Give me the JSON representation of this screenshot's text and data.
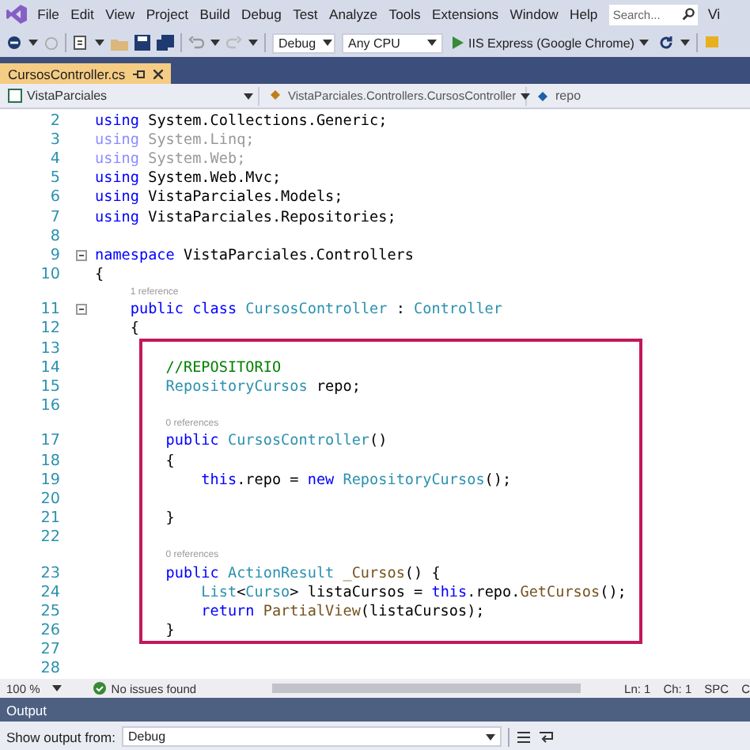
{
  "menu": {
    "items": [
      "File",
      "Edit",
      "View",
      "Project",
      "Build",
      "Debug",
      "Test",
      "Analyze",
      "Tools",
      "Extensions",
      "Window",
      "Help"
    ],
    "search": {
      "placeholder": "Search..."
    },
    "cut_label": "Vi"
  },
  "toolbar": {
    "configuration": "Debug",
    "platform": "Any CPU",
    "run_target": "IIS Express (Google Chrome)"
  },
  "tabs": [
    {
      "label": "CursosController.cs",
      "selected": true
    }
  ],
  "navigation": {
    "project": "VistaParciales",
    "type": "VistaParciales.Controllers.CursosController",
    "member": "repo"
  },
  "editor": {
    "sections": [
      {
        "highlighted": false,
        "rows": [
          {
            "kind": "line",
            "number": "2",
            "fold": false,
            "tokens": [
              {
                "text": "using",
                "kind": "keyword"
              },
              {
                "text": " System.Collections.Generic;",
                "kind": "plain"
              }
            ]
          },
          {
            "kind": "line",
            "number": "3",
            "fold": false,
            "tokens": [
              {
                "text": "using",
                "kind": "dim-keyword"
              },
              {
                "text": " System.Linq;",
                "kind": "dim"
              }
            ]
          },
          {
            "kind": "line",
            "number": "4",
            "fold": false,
            "tokens": [
              {
                "text": "using",
                "kind": "dim-keyword"
              },
              {
                "text": " System.Web;",
                "kind": "dim"
              }
            ]
          },
          {
            "kind": "line",
            "number": "5",
            "fold": false,
            "tokens": [
              {
                "text": "using",
                "kind": "keyword"
              },
              {
                "text": " System.Web.Mvc;",
                "kind": "plain"
              }
            ]
          },
          {
            "kind": "line",
            "number": "6",
            "fold": false,
            "tokens": [
              {
                "text": "using",
                "kind": "keyword"
              },
              {
                "text": " VistaParciales.Models;",
                "kind": "plain"
              }
            ]
          },
          {
            "kind": "line",
            "number": "7",
            "fold": false,
            "tokens": [
              {
                "text": "using",
                "kind": "keyword"
              },
              {
                "text": " VistaParciales.Repositories;",
                "kind": "plain"
              }
            ]
          },
          {
            "kind": "line",
            "number": "8",
            "fold": false,
            "tokens": []
          },
          {
            "kind": "line",
            "number": "9",
            "fold": true,
            "tokens": [
              {
                "text": "namespace",
                "kind": "keyword"
              },
              {
                "text": " VistaParciales.Controllers",
                "kind": "plain"
              }
            ]
          },
          {
            "kind": "line",
            "number": "10",
            "fold": false,
            "tokens": [
              {
                "text": "{",
                "kind": "plain"
              }
            ]
          },
          {
            "kind": "codelens",
            "text": "1 reference"
          },
          {
            "kind": "line",
            "number": "11",
            "fold": true,
            "tokens": [
              {
                "text": "    public",
                "kind": "keyword"
              },
              {
                "text": " class",
                "kind": "keyword"
              },
              {
                "text": " CursosController",
                "kind": "type"
              },
              {
                "text": " : ",
                "kind": "plain"
              },
              {
                "text": "Controller",
                "kind": "type"
              }
            ]
          },
          {
            "kind": "line",
            "number": "12",
            "fold": false,
            "tokens": [
              {
                "text": "    {",
                "kind": "plain"
              }
            ]
          }
        ]
      },
      {
        "highlighted": true,
        "rows": [
          {
            "kind": "line",
            "number": "13",
            "fold": false,
            "tokens": []
          },
          {
            "kind": "line",
            "number": "14",
            "fold": false,
            "tokens": [
              {
                "text": "        //REPOSITORIO",
                "kind": "comment"
              }
            ]
          },
          {
            "kind": "line",
            "number": "15",
            "fold": false,
            "tokens": [
              {
                "text": "        RepositoryCursos",
                "kind": "type"
              },
              {
                "text": " repo;",
                "kind": "plain"
              }
            ]
          },
          {
            "kind": "line",
            "number": "16",
            "fold": false,
            "tokens": []
          },
          {
            "kind": "codelens",
            "text": "0 references"
          },
          {
            "kind": "line",
            "number": "17",
            "fold": false,
            "tokens": [
              {
                "text": "        public",
                "kind": "keyword"
              },
              {
                "text": " CursosController",
                "kind": "type"
              },
              {
                "text": "()",
                "kind": "plain"
              }
            ]
          },
          {
            "kind": "line",
            "number": "18",
            "fold": false,
            "tokens": [
              {
                "text": "        {",
                "kind": "plain"
              }
            ]
          },
          {
            "kind": "line",
            "number": "19",
            "fold": false,
            "tokens": [
              {
                "text": "            this",
                "kind": "keyword"
              },
              {
                "text": ".repo = ",
                "kind": "plain"
              },
              {
                "text": "new",
                "kind": "keyword"
              },
              {
                "text": " RepositoryCursos",
                "kind": "type"
              },
              {
                "text": "();",
                "kind": "plain"
              }
            ]
          },
          {
            "kind": "line",
            "number": "20",
            "fold": false,
            "tokens": []
          },
          {
            "kind": "line",
            "number": "21",
            "fold": false,
            "tokens": [
              {
                "text": "        }",
                "kind": "plain"
              }
            ]
          },
          {
            "kind": "line",
            "number": "22",
            "fold": false,
            "tokens": []
          },
          {
            "kind": "codelens",
            "text": "0 references"
          },
          {
            "kind": "line",
            "number": "23",
            "fold": false,
            "tokens": [
              {
                "text": "        public",
                "kind": "keyword"
              },
              {
                "text": " ActionResult",
                "kind": "type"
              },
              {
                "text": " _Cursos",
                "kind": "method"
              },
              {
                "text": "() {",
                "kind": "plain"
              }
            ]
          },
          {
            "kind": "line",
            "number": "24",
            "fold": false,
            "tokens": [
              {
                "text": "            List",
                "kind": "type"
              },
              {
                "text": "<",
                "kind": "plain"
              },
              {
                "text": "Curso",
                "kind": "type"
              },
              {
                "text": "> listaCursos = ",
                "kind": "plain"
              },
              {
                "text": "this",
                "kind": "keyword"
              },
              {
                "text": ".repo.",
                "kind": "plain"
              },
              {
                "text": "GetCursos",
                "kind": "method"
              },
              {
                "text": "();",
                "kind": "plain"
              }
            ]
          },
          {
            "kind": "line",
            "number": "25",
            "fold": false,
            "tokens": [
              {
                "text": "            return",
                "kind": "keyword"
              },
              {
                "text": " PartialView",
                "kind": "method"
              },
              {
                "text": "(listaCursos);",
                "kind": "plain"
              }
            ]
          },
          {
            "kind": "line",
            "number": "26",
            "fold": false,
            "tokens": [
              {
                "text": "        }",
                "kind": "plain"
              }
            ]
          }
        ]
      },
      {
        "highlighted": false,
        "rows": [
          {
            "kind": "line",
            "number": "27",
            "fold": false,
            "tokens": []
          },
          {
            "kind": "line",
            "number": "28",
            "fold": false,
            "tokens": []
          }
        ]
      }
    ]
  },
  "status_bar": {
    "zoom": "100 %",
    "issues": "No issues found",
    "line": "Ln: 1",
    "column": "Ch: 1",
    "whitespace": "SPC",
    "cut_label": "C"
  },
  "output": {
    "title": "Output",
    "source_label": "Show output from:",
    "source": "Debug"
  }
}
